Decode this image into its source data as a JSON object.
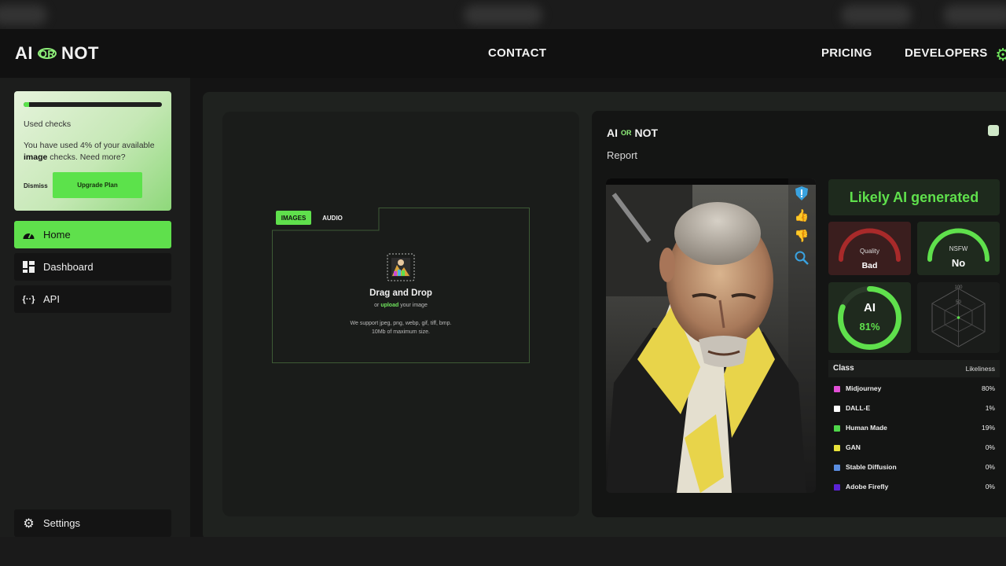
{
  "brand": {
    "left": "AI",
    "or": "OR",
    "right": "NOT"
  },
  "nav": {
    "contact": "CONTACT",
    "pricing": "PRICING",
    "developers": "DEVELOPERS"
  },
  "usage": {
    "title": "Used checks",
    "text_pre": "You have used 4% of your available ",
    "text_bold": "image",
    "text_post": " checks. Need more?",
    "percent_used": 4,
    "dismiss": "Dismiss",
    "upgrade": "Upgrade Plan"
  },
  "sidebar": {
    "items": [
      {
        "label": "Home",
        "icon": "gauge-icon",
        "glyph": "◔",
        "active": true
      },
      {
        "label": "Dashboard",
        "icon": "dashboard-icon",
        "glyph": "▦",
        "active": false
      },
      {
        "label": "API",
        "icon": "code-braces-icon",
        "glyph": "{··}",
        "active": false
      }
    ],
    "settings": "Settings"
  },
  "upload": {
    "tabs": [
      "IMAGES",
      "AUDIO"
    ],
    "title": "Drag and Drop",
    "sub_pre": "or ",
    "sub_link": "upload",
    "sub_post": " your image",
    "formats": "We support jpeg, png, webp, gif, tiff, bmp. 10Mb of maximum size."
  },
  "report": {
    "subtitle": "Report",
    "verdict": "Likely AI generated",
    "quality": {
      "label": "Quality",
      "value": "Bad"
    },
    "nsfw": {
      "label": "NSFW",
      "value": "No"
    },
    "ai": {
      "label": "AI",
      "value": "81%",
      "percent": 81
    },
    "radar_ticks": [
      "100",
      "50"
    ],
    "class_header": "Class",
    "likeliness_header": "Likeliness",
    "classes": [
      {
        "name": "Midjourney",
        "pct": "80%",
        "color": "#e24fd6"
      },
      {
        "name": "DALL-E",
        "pct": "1%",
        "color": "#ffffff"
      },
      {
        "name": "Human Made",
        "pct": "19%",
        "color": "#4fd64a"
      },
      {
        "name": "GAN",
        "pct": "0%",
        "color": "#e8e23a"
      },
      {
        "name": "Stable Diffusion",
        "pct": "0%",
        "color": "#5a8de0"
      },
      {
        "name": "Adobe Firefly",
        "pct": "0%",
        "color": "#5a23d6"
      }
    ]
  },
  "colors": {
    "accent": "#5fe04c",
    "bg": "#141414"
  }
}
